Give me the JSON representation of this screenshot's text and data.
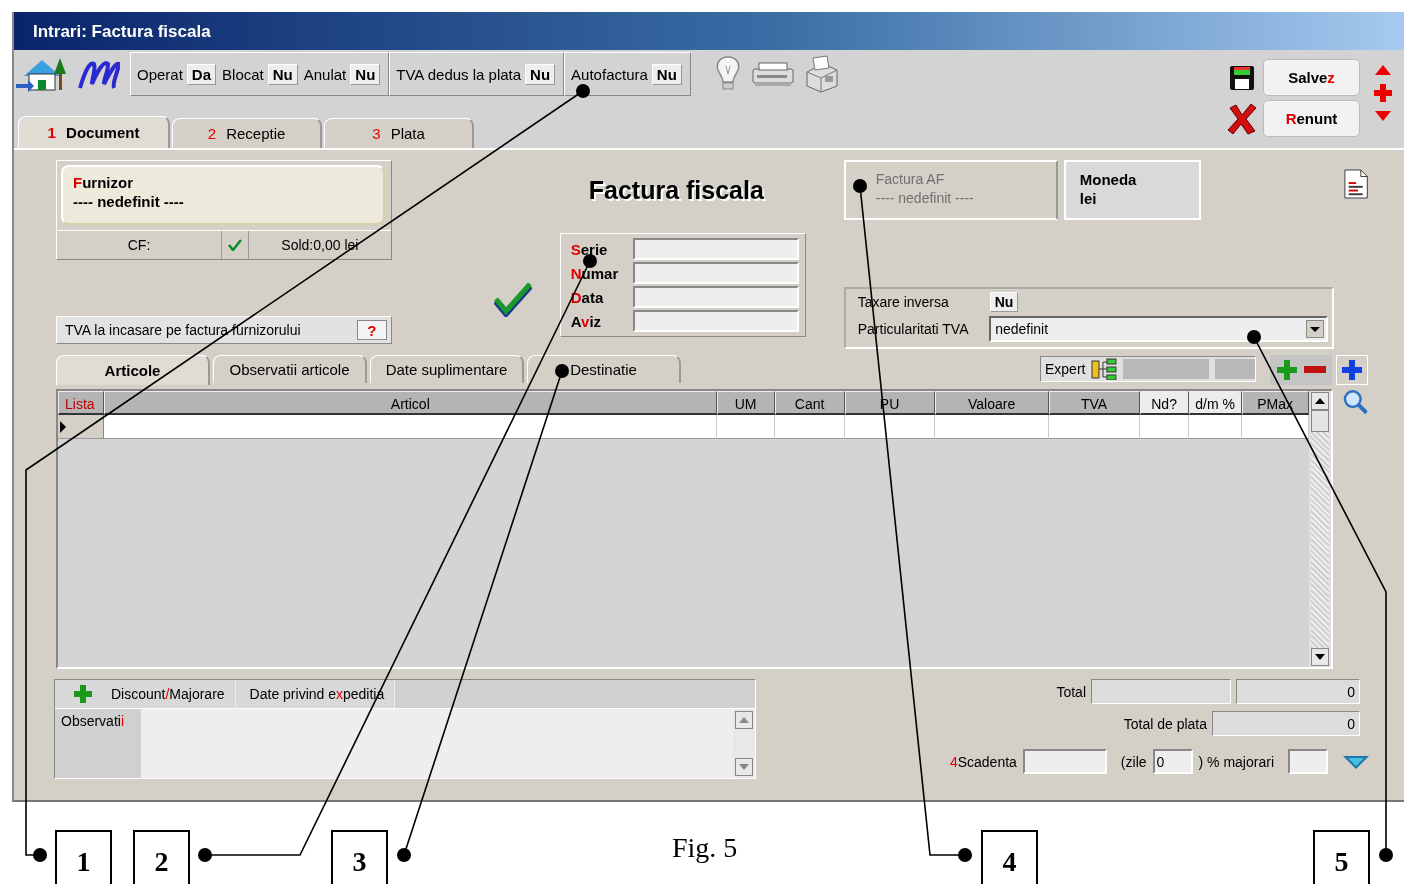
{
  "window": {
    "title": "Intrari: Factura fiscala"
  },
  "toolbar": {
    "flags": [
      {
        "label": "Operat",
        "value": "Da"
      },
      {
        "label": "Blocat",
        "value": "Nu"
      },
      {
        "label": "Anulat",
        "value": "Nu"
      }
    ],
    "tva_dedus": {
      "label": "TVA dedus la plata",
      "value": "Nu"
    },
    "autofactura": {
      "label": "Autofactura",
      "value": "Nu"
    }
  },
  "actions": [
    {
      "kind": "save",
      "before": "Salve",
      "accent": "z"
    },
    {
      "kind": "cancel",
      "accent": "R",
      "after": "enunt"
    }
  ],
  "tabs": [
    {
      "number": "1",
      "label": "Document",
      "selected": true
    },
    {
      "number": "2",
      "label": "Receptie",
      "selected": false
    },
    {
      "number": "3",
      "label": "Plata",
      "selected": false
    }
  ],
  "supplier": {
    "label": {
      "accent": "F",
      "after": "urnizor"
    },
    "value": "---- nedefinit ----",
    "cf": "CF:",
    "cf_valid": true,
    "balance": "Sold:0,00 lei"
  },
  "tva_incasare": {
    "label": "TVA la incasare pe factura furnizorului",
    "value": "?"
  },
  "document_title": "Factura fiscala",
  "validated": true,
  "fields": [
    {
      "label": {
        "accent": "S",
        "after": "erie"
      }
    },
    {
      "label": {
        "accent": "N",
        "after": "umar"
      }
    },
    {
      "label": {
        "accent": "D",
        "after": "ata"
      }
    },
    {
      "label": {
        "before": "A",
        "accent": "v",
        "after": "iz"
      }
    }
  ],
  "factura_af": {
    "label": "Factura AF",
    "value": "---- nedefinit ----",
    "disabled": true
  },
  "currency": {
    "label": "Moneda",
    "value": "lei"
  },
  "taxare_inversa": {
    "label": "Taxare inversa",
    "value": "Nu"
  },
  "particularitati_tva": {
    "label": "Particularitati TVA",
    "value": "nedefinit"
  },
  "sub_tabs": [
    {
      "label": "Articole",
      "selected": true
    },
    {
      "label": "Observatii articole",
      "selected": false
    },
    {
      "label": "Date suplimentare",
      "selected": false
    },
    {
      "label": "Destinatie",
      "selected": false
    }
  ],
  "expert": {
    "label": "Expert"
  },
  "table": {
    "columns": [
      "Lista",
      "Articol",
      "UM",
      "Cant",
      "PU",
      "Valoare",
      "TVA",
      "Nd?",
      "d/m %",
      "PMax"
    ]
  },
  "bottom_tabs": [
    {
      "label": {
        "before": "Discount",
        "accent": "/",
        "after": "Majorare"
      }
    },
    {
      "label": {
        "before": "Date privind e",
        "accent": "x",
        "after": "peditia"
      }
    }
  ],
  "observatii": {
    "label": {
      "before": "Observati",
      "accent": "i"
    }
  },
  "totals": {
    "total": {
      "label": "Total",
      "value": "0"
    },
    "total_de_plata": {
      "label": "Total de plata",
      "value": "0"
    },
    "scadenta": {
      "label": {
        "accent": "4",
        "after": "Scadenta"
      }
    },
    "zile_open": "(zile",
    "zile_value": "0",
    "majorari": ") % majorari"
  },
  "callouts": [
    "1",
    "2",
    "3",
    "4",
    "5"
  ],
  "caption": "Fig. 5"
}
